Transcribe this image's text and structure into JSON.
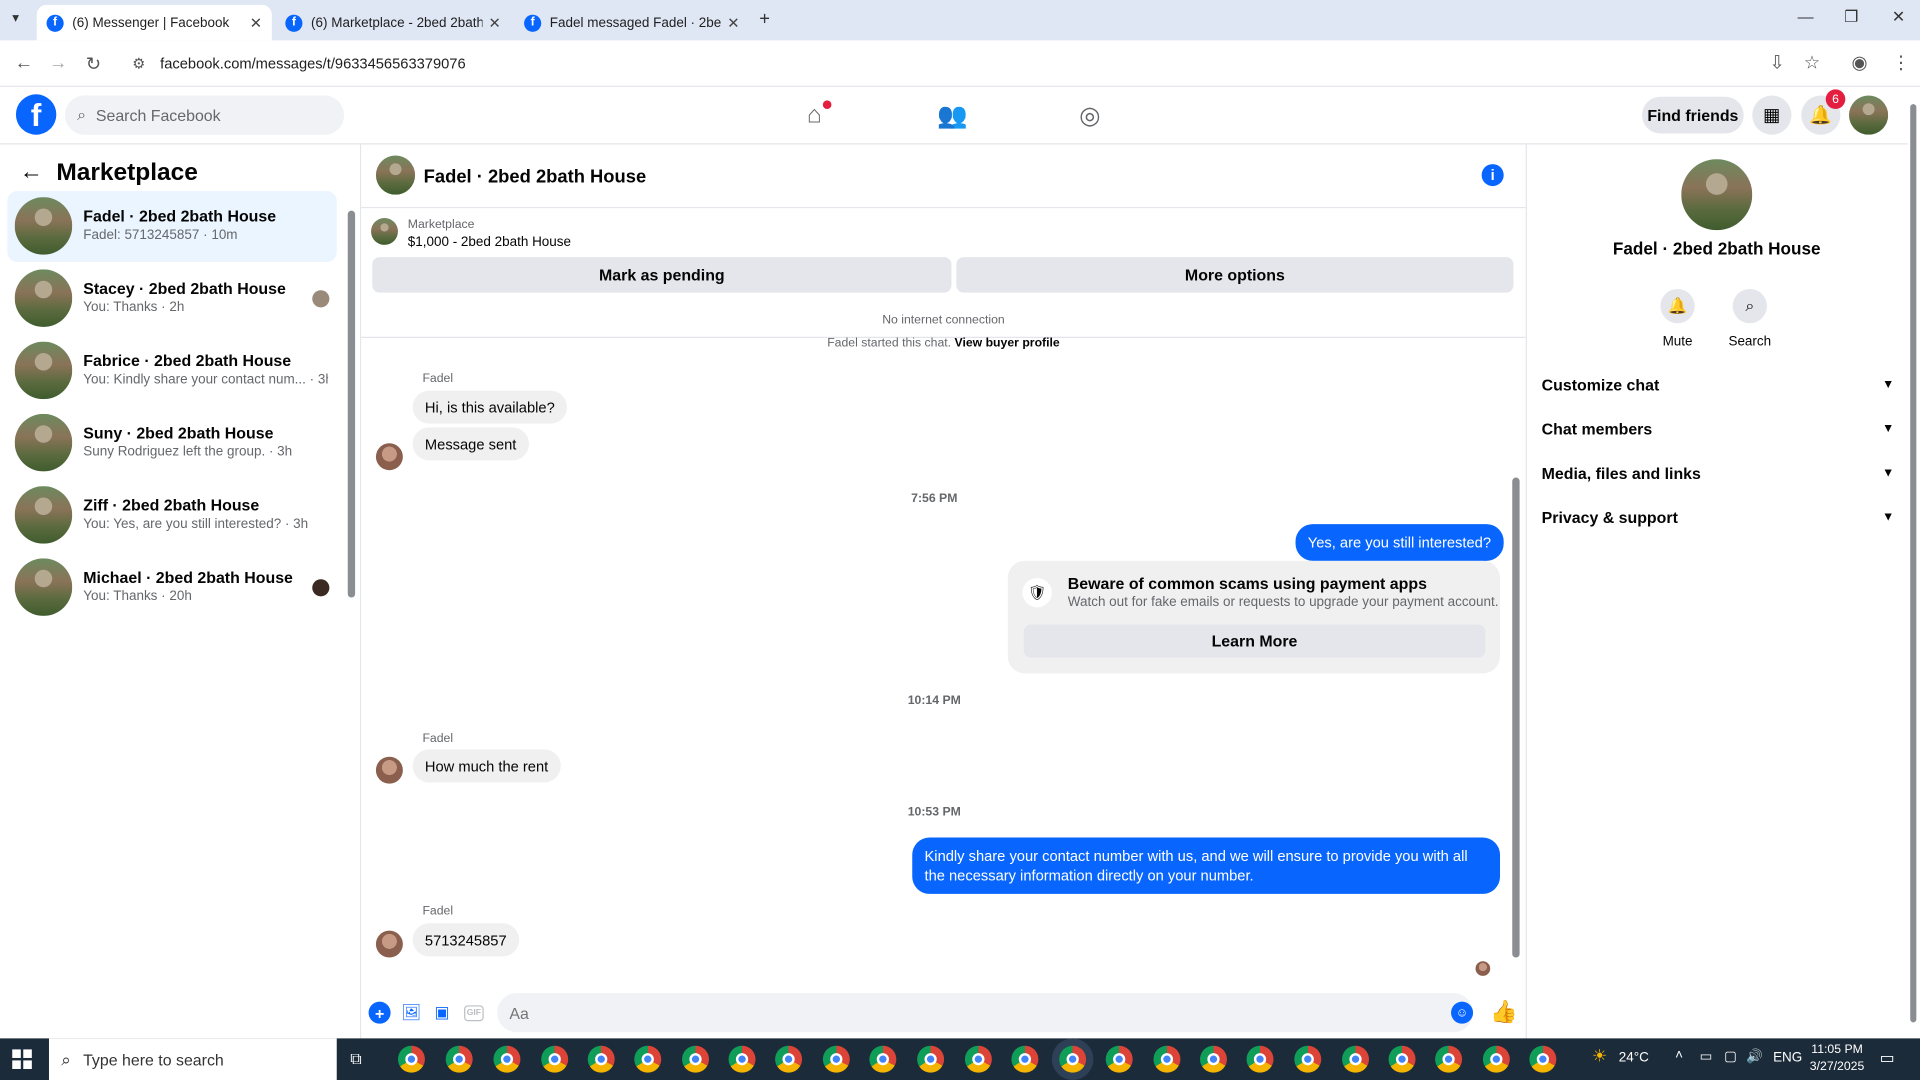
{
  "browser": {
    "tabs": [
      {
        "title": "(6) Messenger | Facebook",
        "active": true
      },
      {
        "title": "(6) Marketplace - 2bed 2bath House",
        "active": false
      },
      {
        "title": "Fadel messaged Fadel · 2bed 2bath House",
        "active": false
      }
    ],
    "url": "facebook.com/messages/t/9633456563379076"
  },
  "fb_header": {
    "search_placeholder": "Search Facebook",
    "find_friends": "Find friends",
    "notification_count": "6"
  },
  "sidebar": {
    "title": "Marketplace",
    "chats": [
      {
        "name": "Fadel · 2bed 2bath House",
        "preview": "Fadel: 5713245857 · 10m",
        "selected": true
      },
      {
        "name": "Stacey · 2bed 2bath House",
        "preview": "You: Thanks · 2h",
        "selected": false
      },
      {
        "name": "Fabrice · 2bed 2bath House",
        "preview": "You: Kindly share your contact num... · 3h",
        "selected": false
      },
      {
        "name": "Suny · 2bed 2bath House",
        "preview": "Suny Rodriguez left the group. · 3h",
        "selected": false
      },
      {
        "name": "Ziff · 2bed 2bath House",
        "preview": "You: Yes, are you still interested? · 3h",
        "selected": false
      },
      {
        "name": "Michael · 2bed 2bath House",
        "preview": "You: Thanks · 20h",
        "selected": false
      }
    ]
  },
  "conversation": {
    "title": "Fadel · 2bed 2bath House",
    "marketplace_label": "Marketplace",
    "listing": "$1,000 - 2bed 2bath House",
    "mark_pending": "Mark as pending",
    "more_options": "More options",
    "no_internet": "No internet connection",
    "started_text": "Fadel started this chat.",
    "view_profile": "View buyer profile",
    "sender_name": "Fadel",
    "msg1": "Hi, is this available?",
    "msg2": "Message sent",
    "time1": "7:56 PM",
    "out1": "Yes, are you still interested?",
    "scam_title": "Beware of common scams using payment apps",
    "scam_body": "Watch out for fake emails or requests to upgrade your payment account.",
    "learn_more": "Learn More",
    "time2": "10:14 PM",
    "msg3": "How much the rent",
    "time3": "10:53 PM",
    "out2": "Kindly share your contact number with us, and we will ensure to provide you with all the necessary information directly on your number.",
    "msg4": "5713245857",
    "composer_placeholder": "Aa"
  },
  "details": {
    "name": "Fadel · 2bed 2bath House",
    "mute": "Mute",
    "search": "Search",
    "sections": [
      "Customize chat",
      "Chat members",
      "Media, files and links",
      "Privacy & support"
    ]
  },
  "taskbar": {
    "search_placeholder": "Type here to search",
    "weather": "24°C",
    "lang": "ENG",
    "time": "11:05 PM",
    "date": "3/27/2025"
  },
  "colors": {
    "fb_blue": "#0866ff",
    "selected_bg": "#ebf5ff",
    "bubble_in": "#f0f0f0",
    "badge_red": "#e41e3f"
  }
}
